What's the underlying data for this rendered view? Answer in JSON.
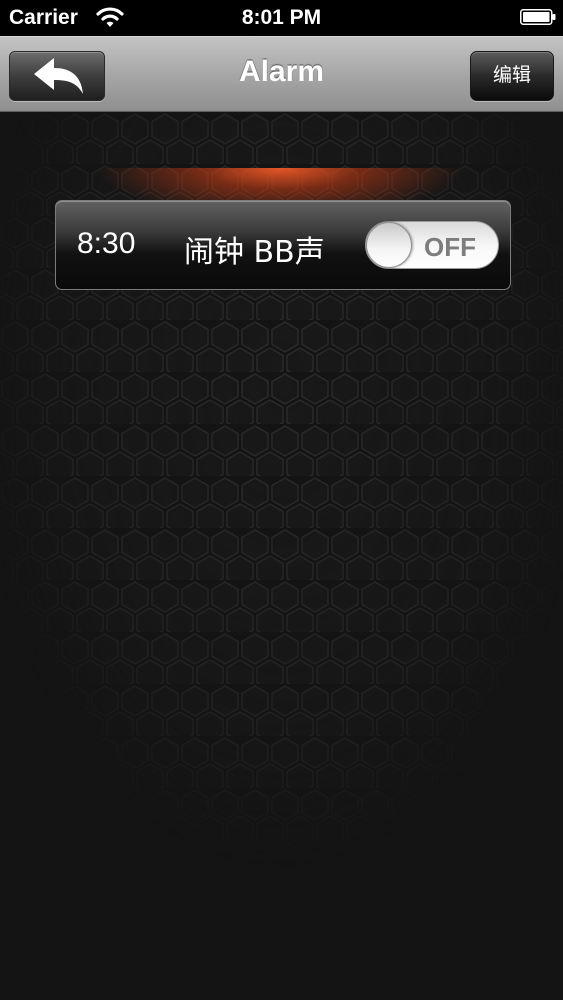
{
  "status_bar": {
    "carrier": "Carrier",
    "time": "8:01 PM",
    "wifi_icon": "wifi-icon",
    "battery_icon": "battery-full-icon"
  },
  "nav_bar": {
    "title": "Alarm",
    "back_icon": "back-arrow-icon",
    "edit_label": "编辑"
  },
  "alarms": [
    {
      "time": "8:30",
      "label": "闹钟 BB声",
      "toggle_label": "OFF",
      "enabled": false
    }
  ],
  "colors": {
    "background": "#141414",
    "glow": "#f05a28",
    "nav_bar": "#a7a7a7",
    "text": "#ffffff"
  }
}
